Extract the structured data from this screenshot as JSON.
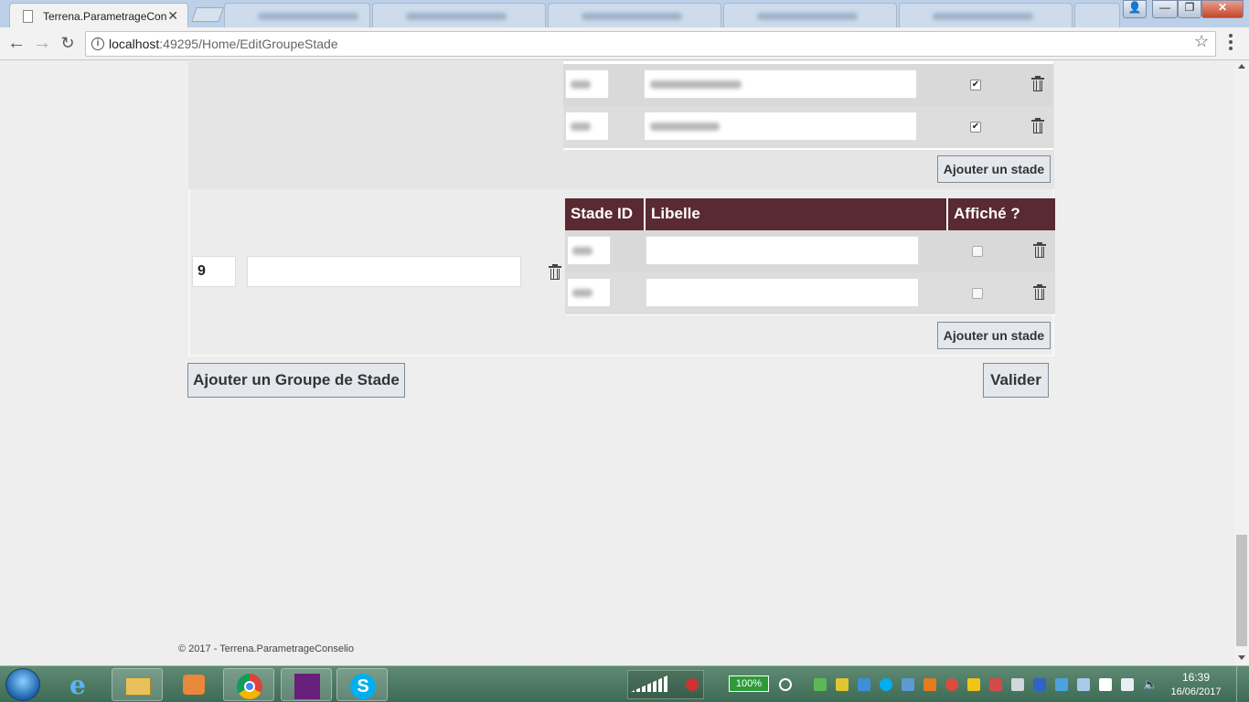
{
  "browser": {
    "active_tab_title": "Terrena.ParametrageCon",
    "tab_close": "✕",
    "url_host": "localhost",
    "url_path": ":49295/Home/EditGroupeStade",
    "window_controls": {
      "minimize": "—",
      "maximize": "❐",
      "close": "✕"
    }
  },
  "group1": {
    "stages": [
      {
        "checked": true
      },
      {
        "checked": true
      }
    ],
    "add_stage_label": "Ajouter un stade"
  },
  "group2": {
    "id": "9",
    "name": "",
    "columns": [
      "Stade ID",
      "Libelle",
      "Affiché ?"
    ],
    "stages": [
      {
        "libelle": "",
        "checked": false
      },
      {
        "libelle": "",
        "checked": false
      }
    ],
    "add_stage_label": "Ajouter un stade"
  },
  "actions": {
    "add_group_label": "Ajouter un Groupe de Stade",
    "validate_label": "Valider"
  },
  "footer": {
    "text": "© 2017 - Terrena.ParametrageConselio"
  },
  "taskbar": {
    "battery": "100%",
    "time": "16:39",
    "date": "16/06/2017"
  },
  "colors": {
    "table_header": "#5a2a32",
    "button_bg": "#e4e8ec"
  }
}
